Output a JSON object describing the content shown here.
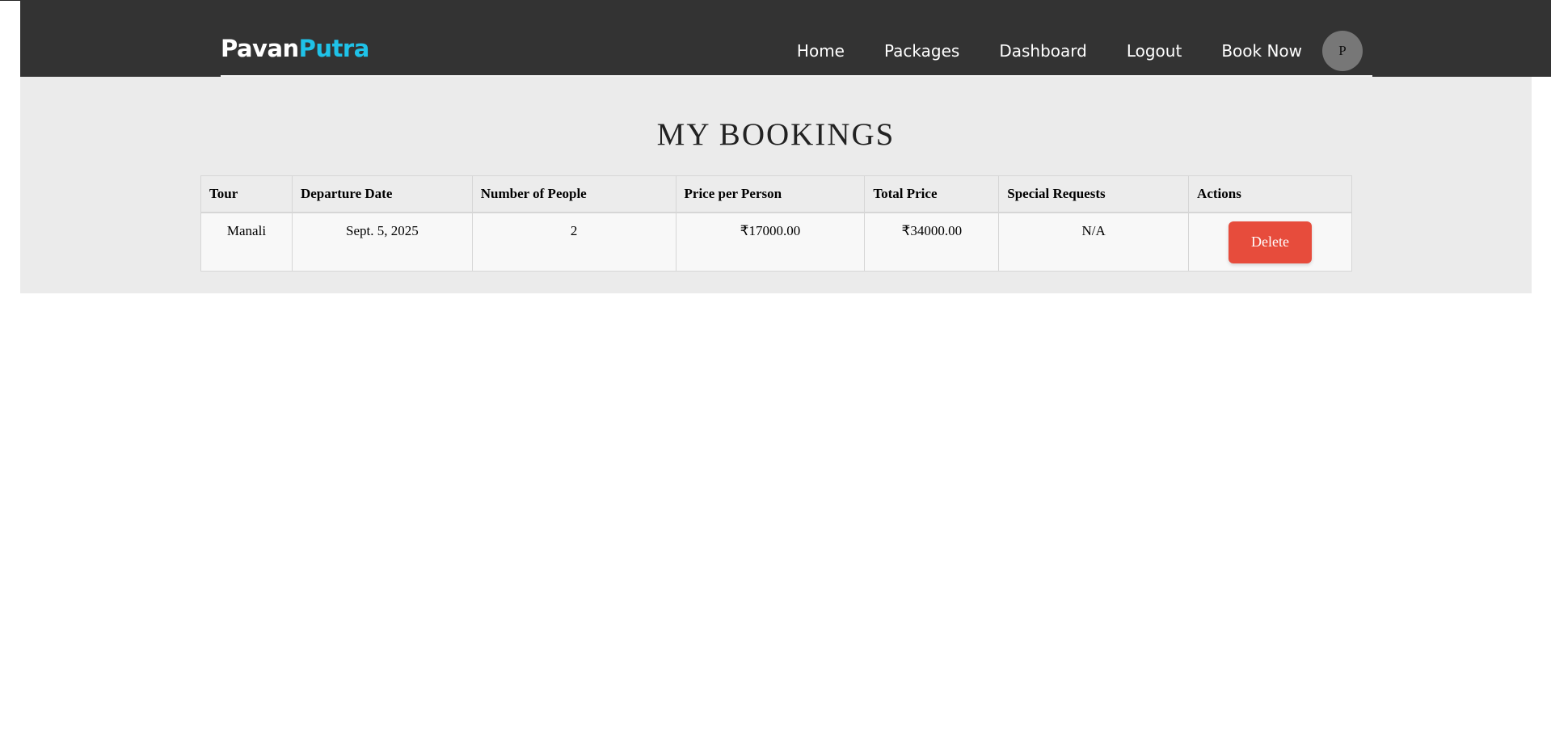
{
  "brand": {
    "name_part1": "Pavan",
    "name_part2": "Putra",
    "accent_color": "#1fc2e8"
  },
  "nav": {
    "items": [
      "Home",
      "Packages",
      "Dashboard",
      "Logout",
      "Book Now"
    ],
    "avatar_initial": "P"
  },
  "page": {
    "title": "MY BOOKINGS"
  },
  "table": {
    "columns": [
      "Tour",
      "Departure Date",
      "Number of People",
      "Price per Person",
      "Total Price",
      "Special Requests",
      "Actions"
    ],
    "rows": [
      {
        "tour": "Manali",
        "departure_date": "Sept. 5, 2025",
        "people": "2",
        "price_per_person": "₹17000.00",
        "total_price": "₹34000.00",
        "special_requests": "N/A",
        "action_label": "Delete"
      }
    ]
  },
  "colors": {
    "header_bg": "#333333",
    "content_bg": "#ebebeb",
    "delete_button": "#e74c3c"
  }
}
